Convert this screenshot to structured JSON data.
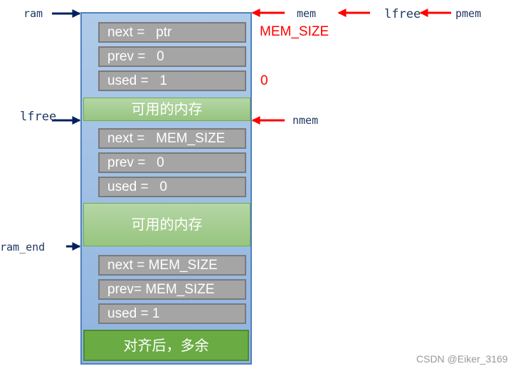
{
  "pointers": {
    "ram": "ram",
    "mem": "mem",
    "lfree_top": "lfree",
    "pmem": "pmem",
    "lfree_left": "lfree",
    "nmem": "nmem",
    "ram_end": "ram_end"
  },
  "annotations": {
    "mem_size": "MEM_SIZE",
    "zero": "0"
  },
  "block1": {
    "next": "next =   ptr",
    "prev": "prev =   0",
    "used": "used =   1"
  },
  "free1": "可用的内存",
  "block2": {
    "next": "next =   MEM_SIZE",
    "prev": "prev =   0",
    "used": "used =   0"
  },
  "free2": "可用的内存",
  "block3": {
    "next": "next = MEM_SIZE",
    "prev": "prev= MEM_SIZE",
    "used": "used = 1"
  },
  "aligned_extra": "对齐后，多余",
  "watermark": "CSDN @Eiker_3169",
  "colors": {
    "pointer_dark": "#002060",
    "pointer_red": "#ff0000",
    "block_blue": "#8fb4e0",
    "field_gray": "#a5a5a5",
    "free_green": "#a9d18e",
    "extra_green": "#6aab43"
  }
}
